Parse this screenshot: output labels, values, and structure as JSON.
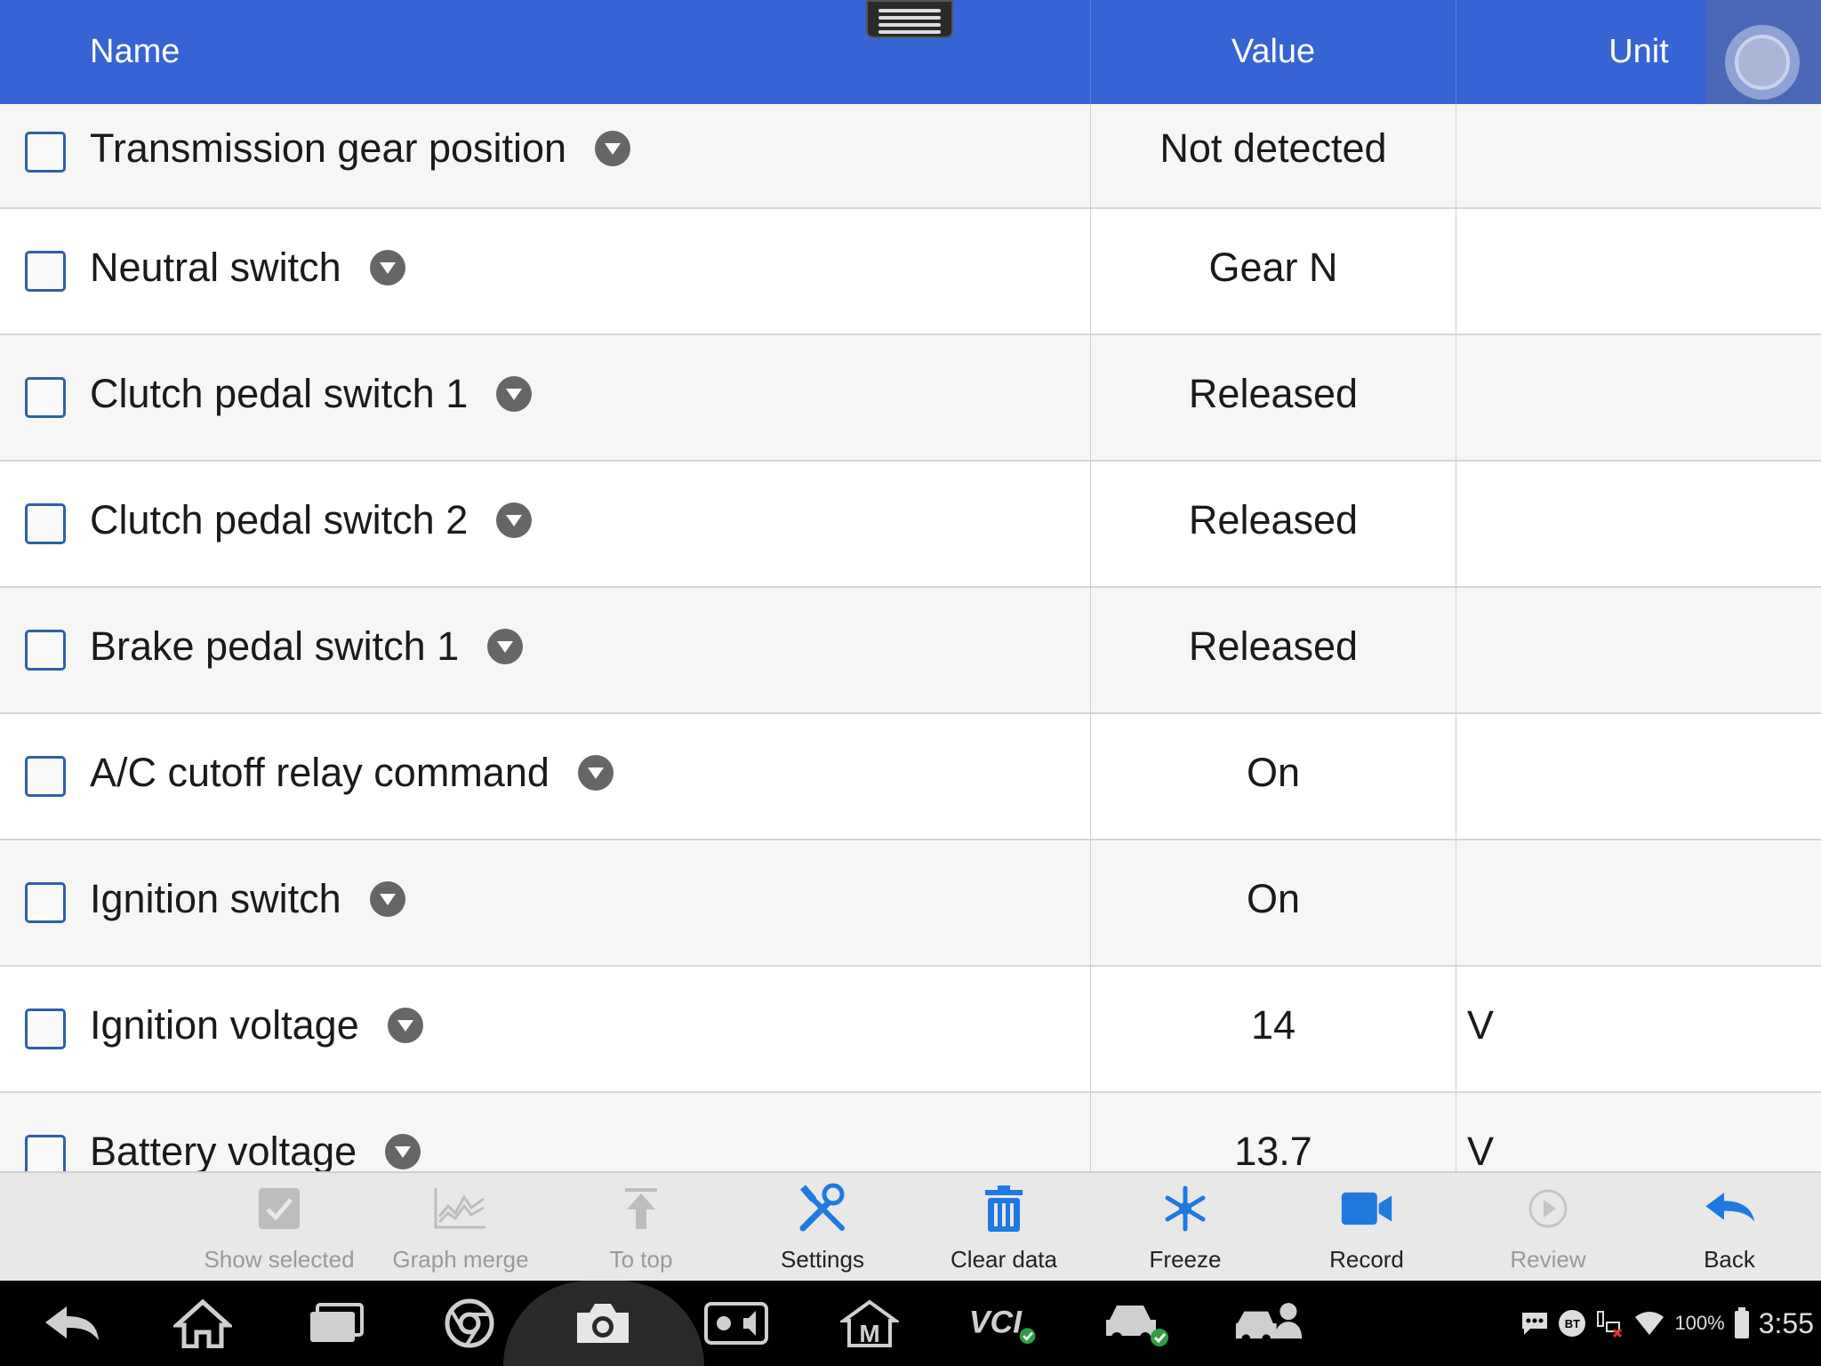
{
  "header": {
    "name": "Name",
    "value": "Value",
    "unit": "Unit"
  },
  "rows": [
    {
      "name": "Transmission gear position",
      "value": "Not detected",
      "unit": ""
    },
    {
      "name": "Neutral switch",
      "value": "Gear N",
      "unit": ""
    },
    {
      "name": "Clutch pedal switch 1",
      "value": "Released",
      "unit": ""
    },
    {
      "name": "Clutch pedal switch 2",
      "value": "Released",
      "unit": ""
    },
    {
      "name": "Brake pedal switch 1",
      "value": "Released",
      "unit": ""
    },
    {
      "name": "A/C cutoff relay command",
      "value": "On",
      "unit": ""
    },
    {
      "name": "Ignition switch",
      "value": "On",
      "unit": ""
    },
    {
      "name": "Ignition voltage",
      "value": "14",
      "unit": "V"
    },
    {
      "name": "Battery voltage",
      "value": "13.7",
      "unit": "V"
    }
  ],
  "toolbar": {
    "show_selected": "Show selected",
    "graph_merge": "Graph merge",
    "to_top": "To top",
    "settings": "Settings",
    "clear_data": "Clear data",
    "freeze": "Freeze",
    "record": "Record",
    "review": "Review",
    "back": "Back"
  },
  "status": {
    "battery": "100%",
    "time": "3:55",
    "bt": "BT"
  },
  "colors": {
    "header": "#3664d4",
    "accent": "#1f7ae0",
    "disabled": "#9a9a9a"
  }
}
